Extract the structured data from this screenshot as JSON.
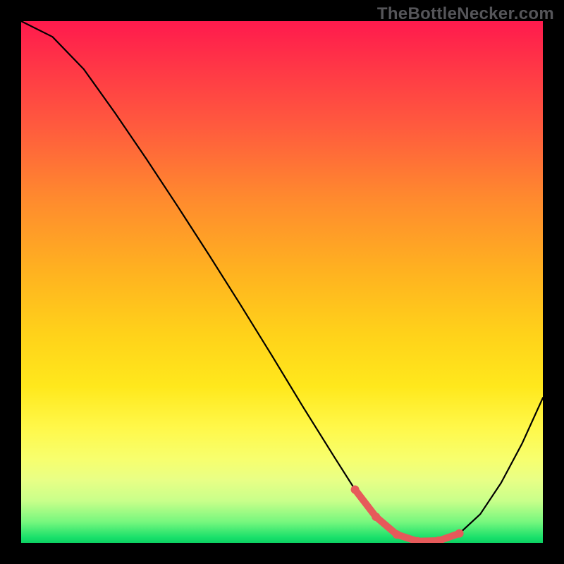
{
  "watermark": "TheBottleNecker.com",
  "chart_data": {
    "type": "line",
    "title": "",
    "xlabel": "",
    "ylabel": "",
    "xlim": [
      0,
      100
    ],
    "ylim": [
      0,
      100
    ],
    "x": [
      0,
      6,
      12,
      18,
      24,
      30,
      36,
      42,
      48,
      54,
      60,
      64,
      68,
      72,
      76,
      80,
      84,
      88,
      92,
      96,
      100
    ],
    "values": [
      100,
      97,
      90.8,
      82.4,
      73.6,
      64.5,
      55.2,
      45.7,
      36.0,
      26.1,
      16.5,
      10.2,
      5.0,
      1.6,
      0.3,
      0.4,
      1.8,
      5.5,
      11.5,
      19.0,
      27.8
    ],
    "highlight_segment": {
      "x_start": 64,
      "x_end": 86
    },
    "gradient_map": "bottleneck % (high=red, low=green)"
  }
}
